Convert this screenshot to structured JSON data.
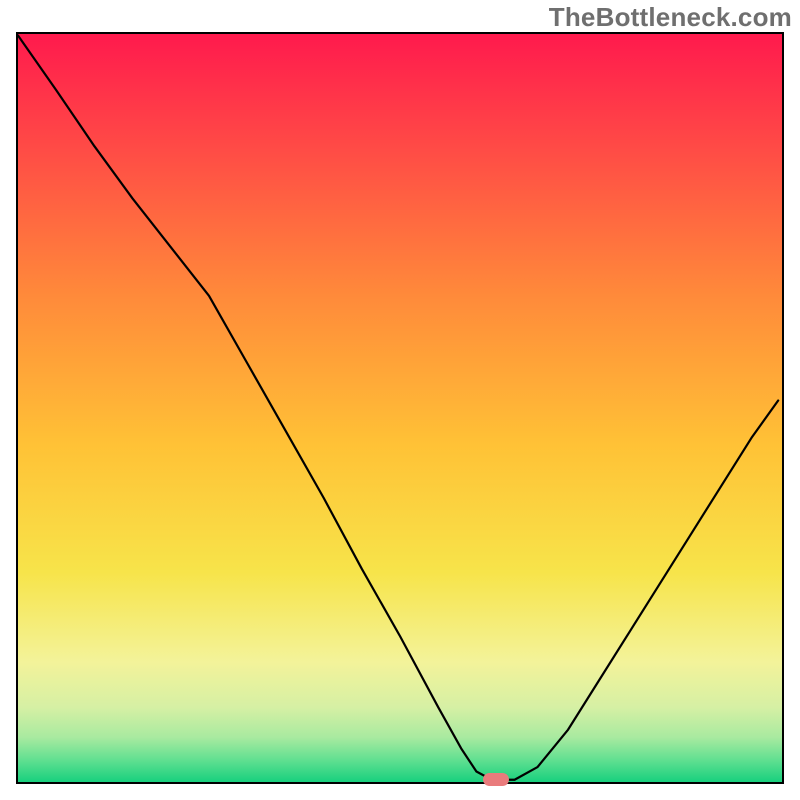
{
  "watermark": "TheBottleneck.com",
  "chart_data": {
    "type": "line",
    "title": "",
    "xlabel": "",
    "ylabel": "",
    "xlim": [
      0,
      100
    ],
    "ylim": [
      0,
      100
    ],
    "x": [
      0,
      5,
      10,
      15,
      20,
      25,
      30,
      35,
      40,
      45,
      50,
      55,
      58,
      60,
      62,
      65,
      68,
      72,
      76,
      80,
      84,
      88,
      92,
      96,
      99.5
    ],
    "y": [
      99.8,
      92.5,
      85.0,
      78.0,
      71.5,
      65.0,
      56.0,
      47.0,
      38.0,
      28.5,
      19.5,
      10.0,
      4.5,
      1.4,
      0.3,
      0.3,
      2.0,
      7.0,
      13.5,
      20.0,
      26.5,
      33.0,
      39.5,
      46.0,
      51.0
    ],
    "marker": {
      "x": 62.5,
      "y": 0.35,
      "color": "#e97b7c"
    },
    "background": {
      "type": "gradient-vertical",
      "stops": [
        {
          "pos": 0.0,
          "color": "#ff1a4d"
        },
        {
          "pos": 0.15,
          "color": "#ff4a46"
        },
        {
          "pos": 0.35,
          "color": "#ff8a3a"
        },
        {
          "pos": 0.55,
          "color": "#ffc236"
        },
        {
          "pos": 0.72,
          "color": "#f7e44a"
        },
        {
          "pos": 0.84,
          "color": "#f3f39a"
        },
        {
          "pos": 0.9,
          "color": "#d6f0a4"
        },
        {
          "pos": 0.94,
          "color": "#a9eaa0"
        },
        {
          "pos": 0.97,
          "color": "#62e091"
        },
        {
          "pos": 1.0,
          "color": "#18d07e"
        }
      ]
    }
  }
}
